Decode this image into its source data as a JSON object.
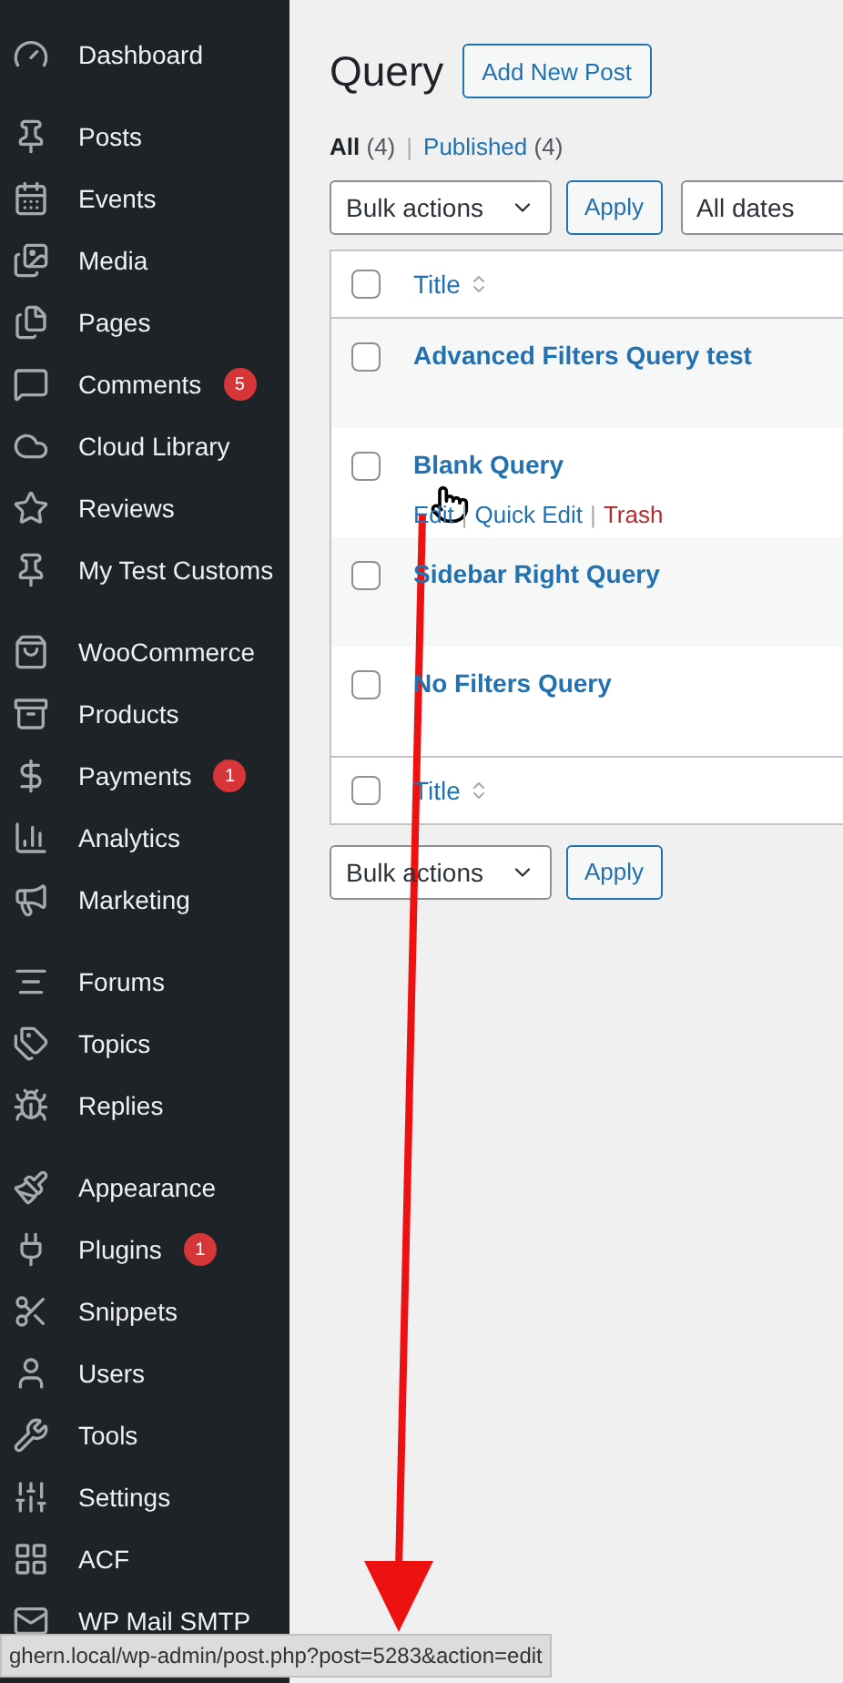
{
  "sidebar": {
    "groups": [
      {
        "items": [
          {
            "label": "Dashboard"
          }
        ]
      },
      {
        "items": [
          {
            "label": "Posts"
          },
          {
            "label": "Events"
          },
          {
            "label": "Media"
          },
          {
            "label": "Pages"
          },
          {
            "label": "Comments",
            "badge": "5"
          },
          {
            "label": "Cloud Library"
          },
          {
            "label": "Reviews"
          },
          {
            "label": "My Test Customs"
          }
        ]
      },
      {
        "items": [
          {
            "label": "WooCommerce"
          },
          {
            "label": "Products"
          },
          {
            "label": "Payments",
            "badge": "1"
          },
          {
            "label": "Analytics"
          },
          {
            "label": "Marketing"
          }
        ]
      },
      {
        "items": [
          {
            "label": "Forums"
          },
          {
            "label": "Topics"
          },
          {
            "label": "Replies"
          }
        ]
      },
      {
        "items": [
          {
            "label": "Appearance"
          },
          {
            "label": "Plugins",
            "badge": "1"
          },
          {
            "label": "Snippets"
          },
          {
            "label": "Users"
          },
          {
            "label": "Tools"
          },
          {
            "label": "Settings"
          },
          {
            "label": "ACF"
          },
          {
            "label": "WP Mail SMTP"
          }
        ]
      }
    ]
  },
  "page": {
    "title": "Query",
    "add_button": "Add New Post"
  },
  "filters": [
    {
      "label": "All",
      "count": "(4)",
      "selected": true
    },
    {
      "label": "Published",
      "count": "(4)",
      "selected": false
    }
  ],
  "filter_separator": "|",
  "top_actions": {
    "bulk": "Bulk actions",
    "apply": "Apply",
    "dates": "All dates"
  },
  "table": {
    "column": "Title",
    "header_checked": false,
    "footer_column": "Title",
    "footer_checked": false,
    "action_separator": "|",
    "rows": [
      {
        "title": "Advanced Filters Query test",
        "checked": false
      },
      {
        "title": "Blank Query",
        "checked": false,
        "actions": [
          {
            "label": "Edit",
            "kind": "link"
          },
          {
            "label": "Quick Edit",
            "kind": "link"
          },
          {
            "label": "Trash",
            "kind": "danger"
          }
        ]
      },
      {
        "title": "Sidebar Right Query",
        "checked": false
      },
      {
        "title": "No Filters Query",
        "checked": false
      }
    ]
  },
  "bottom_actions": {
    "bulk": "Bulk actions",
    "apply": "Apply"
  },
  "status_bar": "ghern.local/wp-admin/post.php?post=5283&action=edit"
}
